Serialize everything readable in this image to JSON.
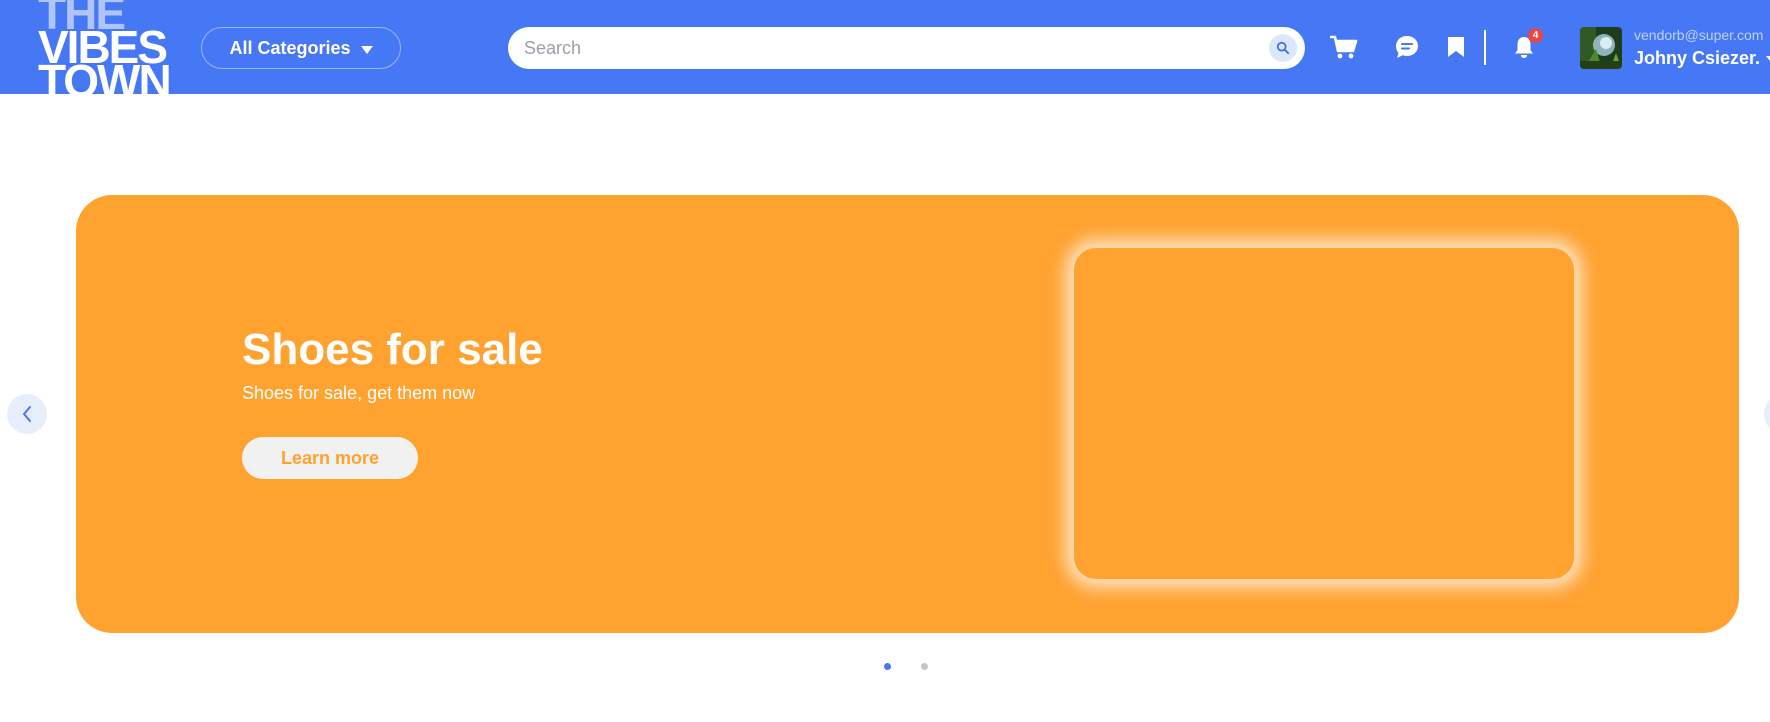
{
  "header": {
    "logo": {
      "line1": "THE",
      "line2": "VIBES",
      "line3": "TOWN"
    },
    "categories_label": "All Categories",
    "search": {
      "placeholder": "Search",
      "value": ""
    },
    "icons": [
      "cart-icon",
      "chat-icon",
      "bookmark-icon",
      "bell-icon"
    ],
    "notifications_count": "4",
    "user": {
      "email": "vendorb@super.com",
      "name": "Johny Csiezer."
    }
  },
  "hero": {
    "title": "Shoes for sale",
    "subtitle": "Shoes for sale, get them now",
    "button_label": "Learn more",
    "slides": 2,
    "active_slide": 1
  },
  "colors": {
    "header": "#4677f5",
    "banner": "#ffa230",
    "dot_active": "#4677f5",
    "dot_inactive": "#c3c7ce"
  }
}
